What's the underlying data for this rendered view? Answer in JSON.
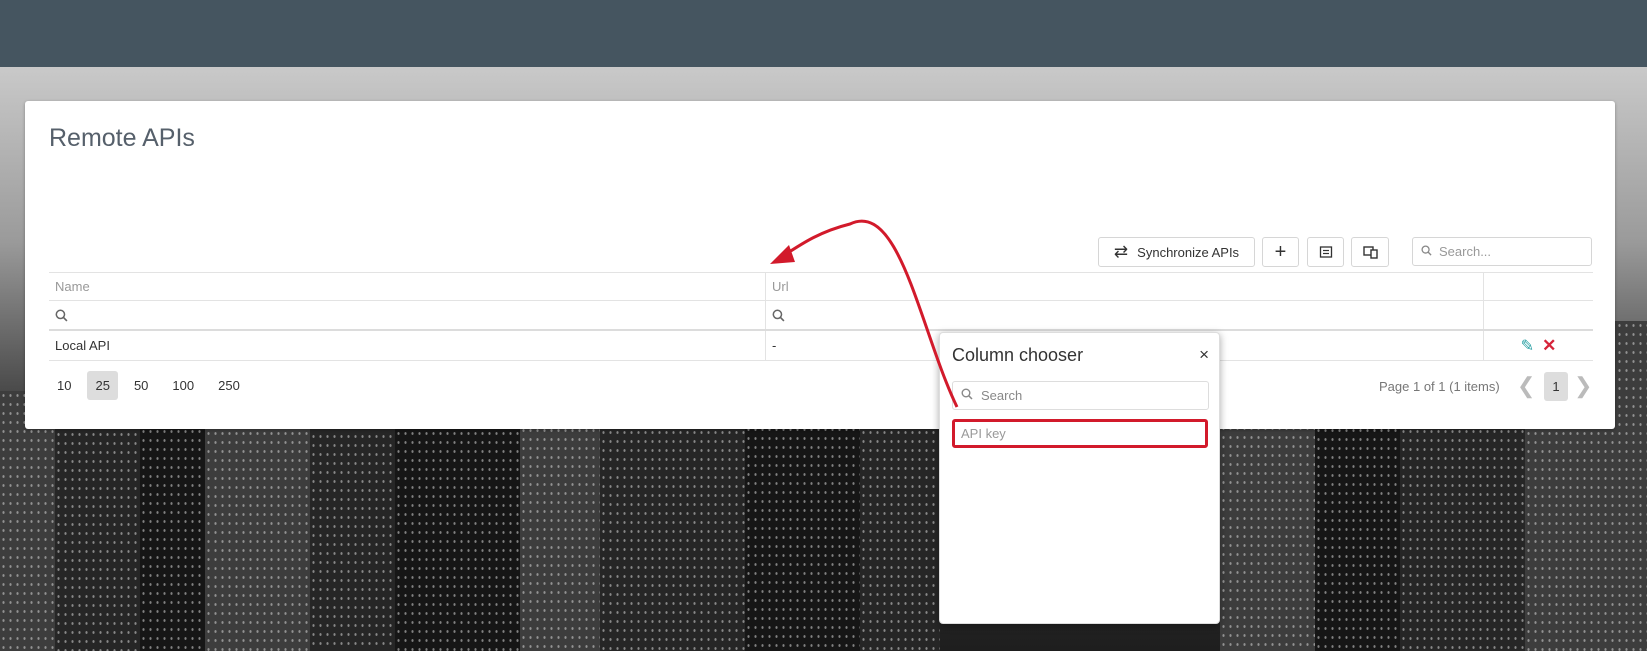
{
  "panel": {
    "title": "Remote APIs"
  },
  "toolbar": {
    "sync_label": "Synchronize APIs",
    "sync_icon": "⇄",
    "add_icon": "+",
    "search_placeholder": "Search..."
  },
  "grid": {
    "columns": [
      "Name",
      "Url"
    ],
    "rows": [
      {
        "name": "Local API",
        "url": "-"
      }
    ]
  },
  "pager": {
    "sizes": [
      "10",
      "25",
      "50",
      "100",
      "250"
    ],
    "selected_size": "25",
    "info": "Page 1 of 1 (1 items)",
    "current_page": "1"
  },
  "column_chooser": {
    "title": "Column chooser",
    "close_icon": "×",
    "search_placeholder": "Search",
    "items": [
      "API key"
    ]
  },
  "colors": {
    "accent_red": "#d21a2b",
    "topbar": "#455560",
    "edit": "#2aa0a4"
  }
}
